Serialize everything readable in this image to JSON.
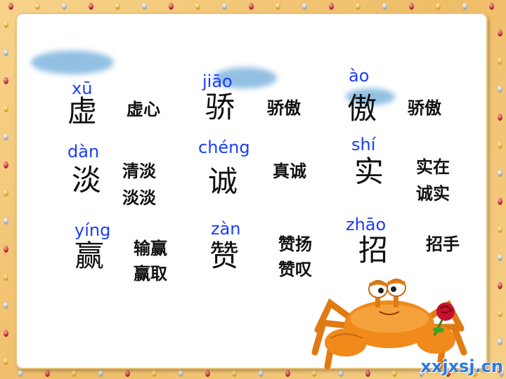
{
  "cards": [
    {
      "pinyin": "xū",
      "char": "虚",
      "words": [
        "虚心"
      ]
    },
    {
      "pinyin": "jiāo",
      "char": "骄",
      "words": [
        "骄傲"
      ]
    },
    {
      "pinyin": "ào",
      "char": "傲",
      "words": [
        "骄傲"
      ]
    },
    {
      "pinyin": "dàn",
      "char": "淡",
      "words": [
        "清淡",
        "淡淡"
      ]
    },
    {
      "pinyin": "chéng",
      "char": "诚",
      "words": [
        "真诚"
      ]
    },
    {
      "pinyin": "shí",
      "char": "实",
      "words": [
        "实在",
        "诚实"
      ]
    },
    {
      "pinyin": "yíng",
      "char": "赢",
      "words": [
        "输赢",
        "赢取"
      ]
    },
    {
      "pinyin": "zàn",
      "char": "赞",
      "words": [
        "赞扬",
        "赞叹"
      ]
    },
    {
      "pinyin": "zhāo",
      "char": "招",
      "words": [
        "招手"
      ]
    }
  ],
  "watermark": "xxjxsj.cn",
  "colors": {
    "pinyin": "#1a3cff",
    "frame": "#f3c878",
    "crab": "#f08a1a"
  },
  "illustration": "crab-holding-rose"
}
